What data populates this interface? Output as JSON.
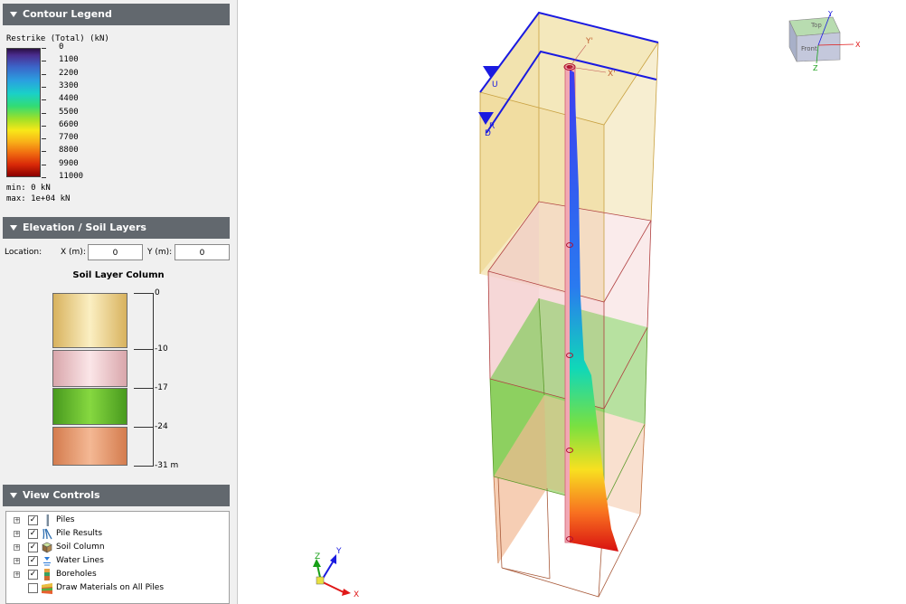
{
  "legend": {
    "title": "Contour Legend",
    "quantity": "Restrike (Total) (kN)",
    "ticks": [
      "0",
      "1100",
      "2200",
      "3300",
      "4400",
      "5500",
      "6600",
      "7700",
      "8800",
      "9900",
      "11000"
    ],
    "min": "min: 0 kN",
    "max": "max: 1e+04 kN"
  },
  "elevation": {
    "title": "Elevation / Soil Layers",
    "location_label": "Location:",
    "x_label": "X (m):",
    "x_value": "0",
    "y_label": "Y (m):",
    "y_value": "0",
    "column_title": "Soil Layer Column",
    "labels": [
      "0",
      "-10",
      "-17",
      "-24",
      "-31 m"
    ],
    "layer_colors": [
      "#ecd89c",
      "#f2cfd2",
      "#6cc238",
      "#eba078"
    ]
  },
  "view_controls": {
    "title": "View Controls",
    "items": [
      {
        "label": "Piles",
        "checked": true,
        "icon": "pile-icon"
      },
      {
        "label": "Pile Results",
        "checked": true,
        "icon": "pile-results-icon"
      },
      {
        "label": "Soil Column",
        "checked": true,
        "icon": "soil-column-icon"
      },
      {
        "label": "Water Lines",
        "checked": true,
        "icon": "water-lines-icon"
      },
      {
        "label": "Boreholes",
        "checked": true,
        "icon": "borehole-icon"
      },
      {
        "label": "Draw Materials on All Piles",
        "checked": false,
        "icon": ""
      }
    ]
  },
  "viewport": {
    "local_axis_labels": [
      "Y'",
      "X'",
      "U",
      "R",
      "D"
    ],
    "triad": {
      "x": "X",
      "y": "Y",
      "z": "Z"
    },
    "view_cube": {
      "top": "Top",
      "front": "Front",
      "x": "X",
      "y": "Y",
      "z": "Z"
    }
  }
}
